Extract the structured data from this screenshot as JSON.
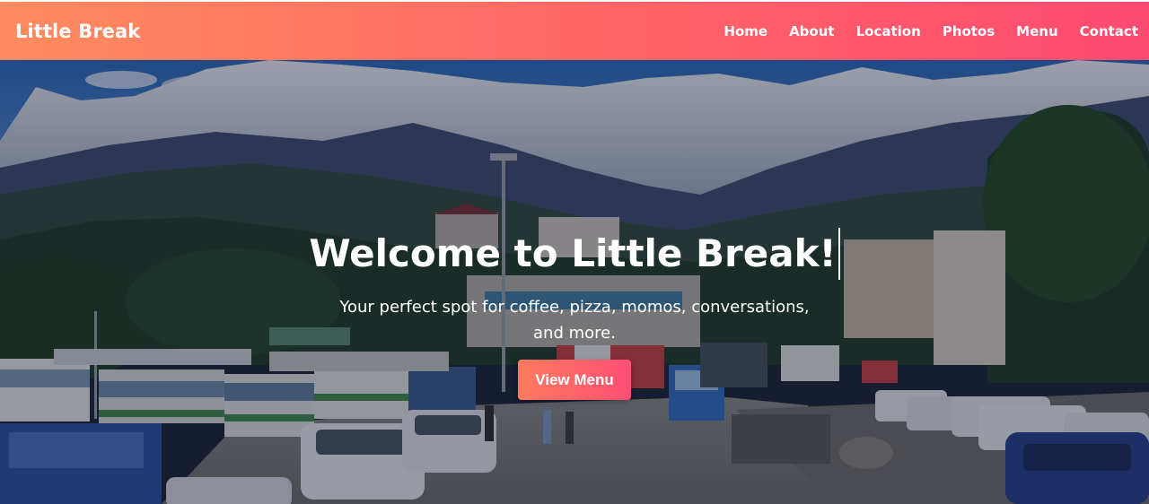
{
  "brand": "Little Break",
  "nav": {
    "items": [
      {
        "label": "Home"
      },
      {
        "label": "About"
      },
      {
        "label": "Location"
      },
      {
        "label": "Photos"
      },
      {
        "label": "Menu"
      },
      {
        "label": "Contact"
      }
    ]
  },
  "hero": {
    "title": "Welcome to Little Break!",
    "subtitle": "Your perfect spot for coffee, pizza, momos, conversations, and more.",
    "cta_label": "View Menu"
  },
  "colors": {
    "nav_gradient_start": "#ff8c5e",
    "nav_gradient_end": "#ff4a72",
    "cta_gradient_start": "#ff7b5f",
    "cta_gradient_end": "#ff4f73"
  }
}
